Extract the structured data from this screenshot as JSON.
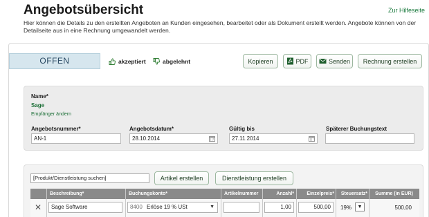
{
  "header": {
    "title": "Angebotsübersicht",
    "help_link": "Zur Hilfeseite",
    "description": "Hier können die Details zu den erstellten Angeboten an Kunden eingesehen, bearbeitet oder als Dokument erstellt werden. Angebote können von der Detailseite aus in eine Rechnung umgewandelt werden."
  },
  "status": {
    "label": "OFFEN",
    "accept_label": "akzeptiert",
    "reject_label": "abgelehnt"
  },
  "toolbar": {
    "copy_label": "Kopieren",
    "pdf_label": "PDF",
    "send_label": "Senden",
    "invoice_label": "Rechnung erstellen"
  },
  "offer": {
    "name_label": "Name*",
    "name_value": "Sage",
    "change_recipient": "Empfänger ändern",
    "number_label": "Angebotsnummer*",
    "number_value": "AN-1",
    "date_label": "Angebotsdatum*",
    "date_value": "28.10.2014",
    "valid_label": "Gültig bis",
    "valid_value": "27.11.2014",
    "booking_text_label": "Späterer Buchungstext",
    "booking_text_value": ""
  },
  "items": {
    "search_value": "[Produkt/Dienstleistung suchen]",
    "create_article_label": "Artikel erstellen",
    "create_service_label": "Dienstleistung erstellen",
    "columns": [
      "Beschreibung*",
      "Buchungskonto*",
      "Artikelnummer",
      "Anzahl*",
      "Einzelpreis*",
      "Steuersatz*",
      "Summe (in EUR)"
    ],
    "rows": [
      {
        "description": "Sage Software",
        "account_number": "8400",
        "account_name": "Erlöse 19 % USt",
        "article_number": "",
        "quantity": "1,00",
        "unit_price": "500,00",
        "tax_rate": "19%",
        "sum": "500,00"
      }
    ]
  },
  "colors": {
    "accent_green": "#1b7a3e",
    "status_bg": "#d6e6ee",
    "table_header": "#8a8a8a"
  },
  "icons": {
    "accept": "thumbs-up-icon",
    "reject": "thumbs-down-icon",
    "pdf": "pdf-icon",
    "send": "envelope-icon",
    "calendar": "calendar-icon",
    "delete": "close-icon"
  }
}
